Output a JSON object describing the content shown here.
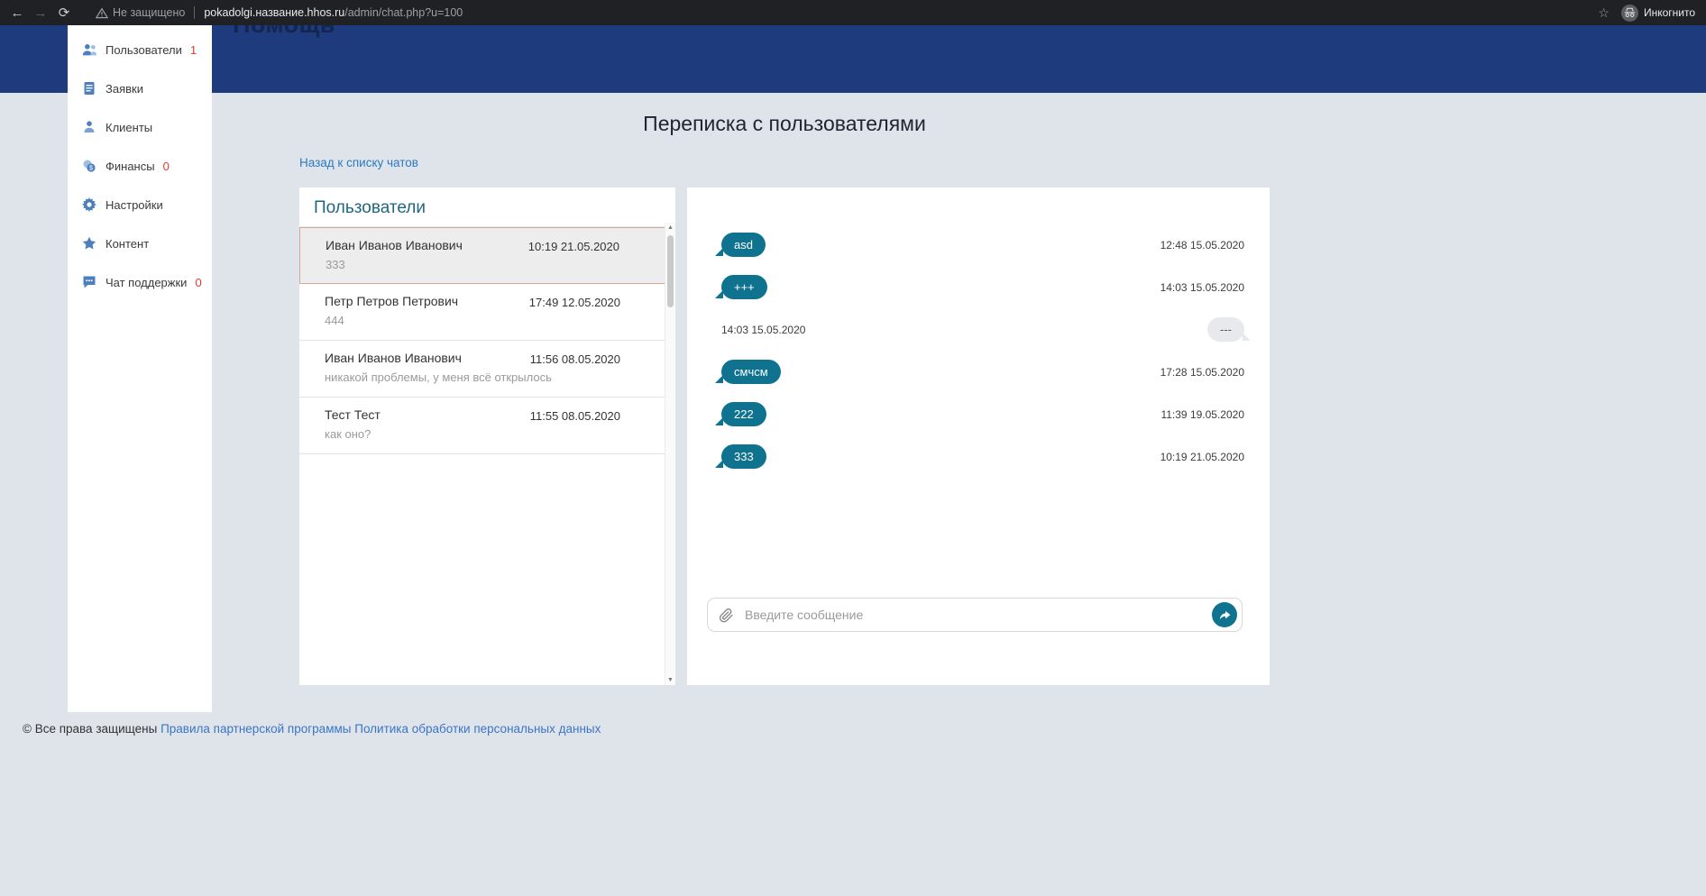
{
  "browser": {
    "security_label": "Не защищено",
    "url_host": "pokadolgi.название.hhos.ru",
    "url_path": "/admin/chat.php?u=100",
    "incognito_label": "Инкогнито"
  },
  "header": {
    "brand": "Помощь"
  },
  "sidebar": {
    "items": [
      {
        "label": "Пользователи",
        "badge": "1",
        "icon": "users-icon"
      },
      {
        "label": "Заявки",
        "badge": "",
        "icon": "requests-icon"
      },
      {
        "label": "Клиенты",
        "badge": "",
        "icon": "clients-icon"
      },
      {
        "label": "Финансы",
        "badge": "0",
        "icon": "finance-icon"
      },
      {
        "label": "Настройки",
        "badge": "",
        "icon": "settings-icon"
      },
      {
        "label": "Контент",
        "badge": "",
        "icon": "content-icon"
      },
      {
        "label": "Чат поддержки",
        "badge": "0",
        "icon": "support-chat-icon"
      }
    ]
  },
  "main": {
    "title": "Переписка с пользователями",
    "back_link": "Назад к списку чатов",
    "chat_list": {
      "header": "Пользователи",
      "items": [
        {
          "name": "Иван Иванов Иванович",
          "time": "10:19 21.05.2020",
          "preview": "333",
          "selected": true
        },
        {
          "name": "Петр Петров Петрович",
          "time": "17:49 12.05.2020",
          "preview": "444",
          "selected": false
        },
        {
          "name": "Иван Иванов Иванович",
          "time": "11:56 08.05.2020",
          "preview": "никакой проблемы, у меня всё открылось",
          "selected": false
        },
        {
          "name": "Тест Тест",
          "time": "11:55 08.05.2020",
          "preview": "как оно?",
          "selected": false
        }
      ]
    },
    "conversation": {
      "messages": [
        {
          "text": "asd",
          "time": "12:48 15.05.2020",
          "side": "left"
        },
        {
          "text": "+++",
          "time": "14:03 15.05.2020",
          "side": "left"
        },
        {
          "text": "---",
          "time": "14:03 15.05.2020",
          "side": "right"
        },
        {
          "text": "смчсм",
          "time": "17:28 15.05.2020",
          "side": "left"
        },
        {
          "text": "222",
          "time": "11:39 19.05.2020",
          "side": "left"
        },
        {
          "text": "333",
          "time": "10:19 21.05.2020",
          "side": "left"
        }
      ],
      "input_placeholder": "Введите сообщение"
    }
  },
  "footer": {
    "copyright": "© Все права защищены",
    "links": [
      "Правила партнерской программы",
      "Политика обработки персональных данных"
    ]
  },
  "colors": {
    "accent_teal": "#0f7390",
    "header_blue": "#1e3c7d",
    "badge_red": "#e03c31",
    "link_blue": "#2b7bc4"
  }
}
